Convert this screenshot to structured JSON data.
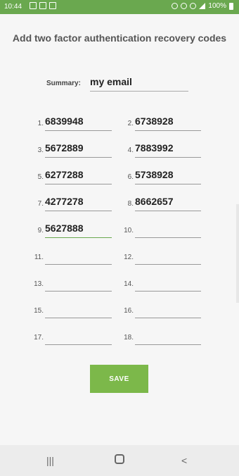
{
  "status_bar": {
    "time": "10:44",
    "battery": "100%"
  },
  "title": "Add two factor authentication recovery codes",
  "summary": {
    "label": "Summary:",
    "value": "my email"
  },
  "codes": [
    {
      "label": "1.",
      "value": "6839948"
    },
    {
      "label": "2.",
      "value": "6738928"
    },
    {
      "label": "3.",
      "value": "5672889"
    },
    {
      "label": "4.",
      "value": "7883992"
    },
    {
      "label": "5.",
      "value": "6277288"
    },
    {
      "label": "6.",
      "value": "5738928"
    },
    {
      "label": "7.",
      "value": "4277278"
    },
    {
      "label": "8.",
      "value": "8662657"
    },
    {
      "label": "9.",
      "value": "5627888"
    },
    {
      "label": "10.",
      "value": ""
    },
    {
      "label": "11.",
      "value": ""
    },
    {
      "label": "12.",
      "value": ""
    },
    {
      "label": "13.",
      "value": ""
    },
    {
      "label": "14.",
      "value": ""
    },
    {
      "label": "15.",
      "value": ""
    },
    {
      "label": "16.",
      "value": ""
    },
    {
      "label": "17.",
      "value": ""
    },
    {
      "label": "18.",
      "value": ""
    }
  ],
  "actions": {
    "save": "SAVE"
  },
  "nav": {
    "recents": "recents-icon",
    "home": "home-icon",
    "back": "back-icon"
  }
}
